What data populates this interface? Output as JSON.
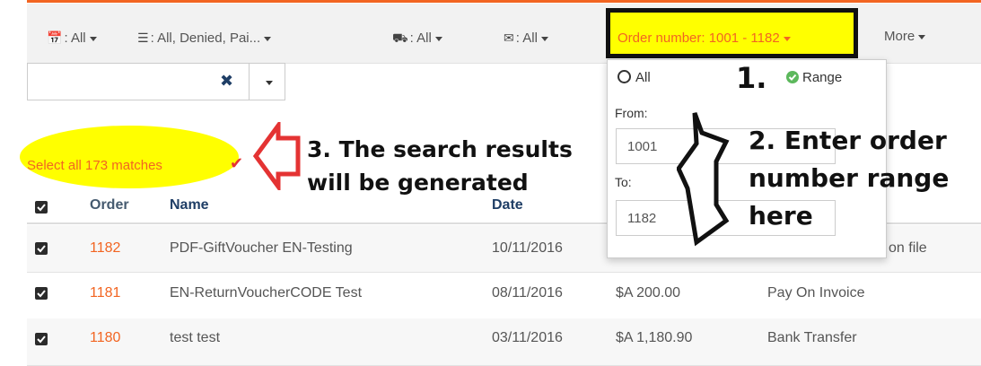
{
  "filters": {
    "date": {
      "icon": "calendar-icon",
      "label": ": All"
    },
    "status": {
      "icon": "database-icon",
      "label": ": All, Denied, Pai..."
    },
    "shipping": {
      "icon": "truck-icon",
      "label": ": All"
    },
    "email": {
      "icon": "envelope-icon",
      "label": ": All"
    },
    "order_number": "Order number: 1001 - 1182",
    "more": "More"
  },
  "search": {
    "value": "",
    "clear_icon": "close-icon"
  },
  "select_all": "Select all 173 matches",
  "table": {
    "headers": {
      "order": "Order",
      "name": "Name",
      "date": "Date"
    },
    "rows": [
      {
        "order": "1182",
        "name": "PDF-GiftVoucher EN-Testing",
        "date": "10/11/2016",
        "amount": "",
        "payment": "on file"
      },
      {
        "order": "1181",
        "name": "EN-ReturnVoucherCODE Test",
        "date": "08/11/2016",
        "amount": "$A 200.00",
        "payment": "Pay On Invoice"
      },
      {
        "order": "1180",
        "name": "test test",
        "date": "03/11/2016",
        "amount": "$A 1,180.90",
        "payment": "Bank Transfer"
      }
    ]
  },
  "range_dropdown": {
    "option_all": "All",
    "option_range": "Range",
    "from_label": "From:",
    "from_value": "1001",
    "to_label": "To:",
    "to_value": "1182"
  },
  "annotations": {
    "step1": "1.",
    "step2_line1": "2. Enter order",
    "step2_line2": "number range",
    "step2_line3": "here",
    "step3_line1": "3. The search results",
    "step3_line2": "will be generated"
  },
  "colors": {
    "accent": "#f26522",
    "highlight": "#ffff00",
    "header_text": "#1f3e66",
    "range_green": "#5cb85c"
  }
}
